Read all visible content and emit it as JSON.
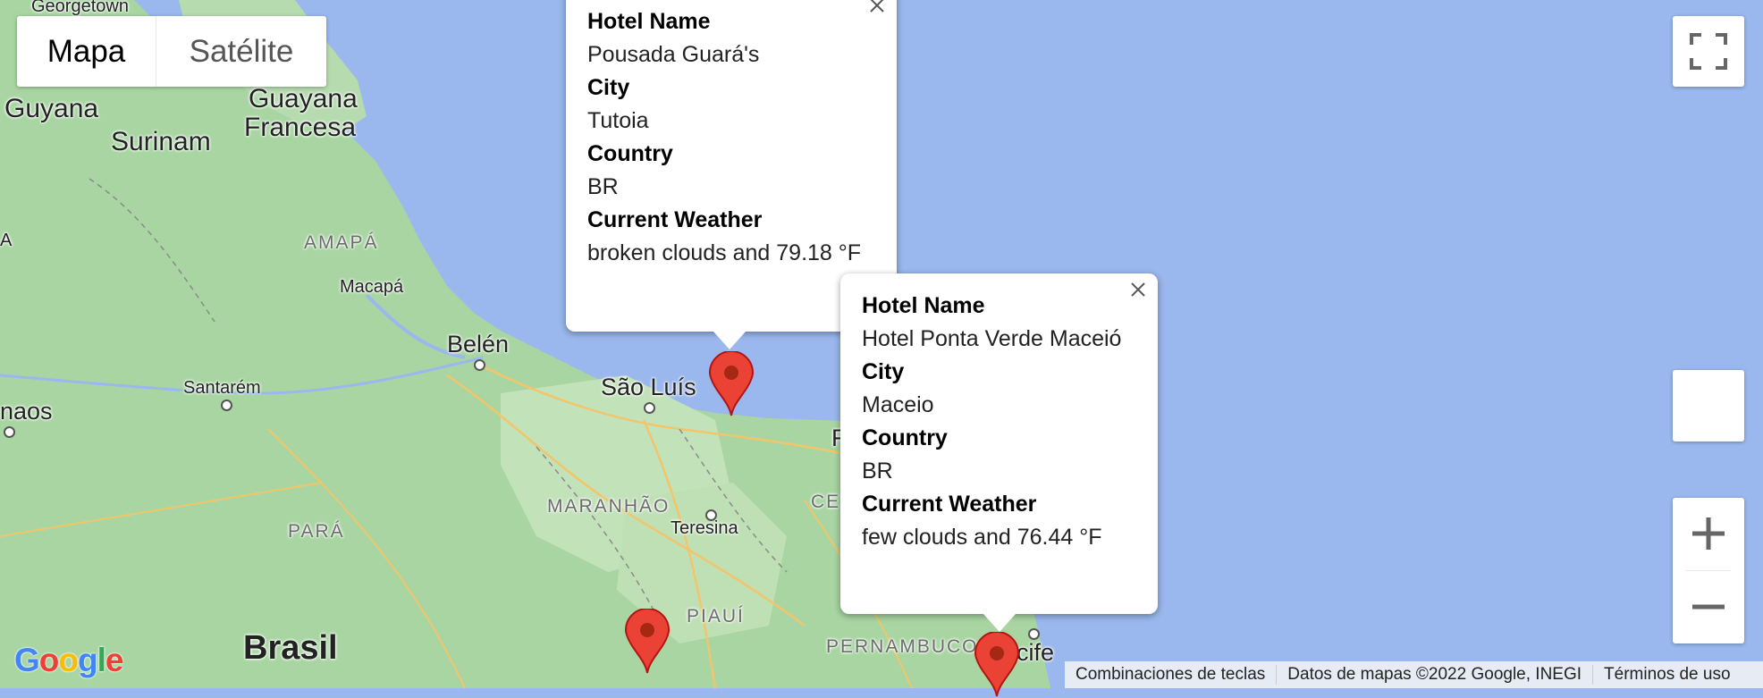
{
  "map": {
    "type_control": {
      "map_label": "Mapa",
      "satellite_label": "Satélite",
      "selected": "Mapa"
    },
    "labels": {
      "georgetown": "Georgetown",
      "guyana": "Guyana",
      "guayana_francesa_1": "Guayana",
      "guayana_francesa_2": "Francesa",
      "surinam": "Surinam",
      "amapa": "AMAPÁ",
      "macapa": "Macapá",
      "belen": "Belén",
      "santarem": "Santarém",
      "manaos": "naos",
      "sao_luis": "São Luís",
      "maranhao": "MARANHÃO",
      "teresina": "Teresina",
      "para": "PARÁ",
      "piaui": "PIAUÍ",
      "pernambuco": "PERNAMBUCO",
      "recife": "ecife",
      "ce": "CE",
      "brasil": "Brasil",
      "a_edge": "A",
      "f_edge": "F"
    },
    "info_windows": [
      {
        "hotel_label": "Hotel Name",
        "hotel": "Pousada Guará's",
        "city_label": "City",
        "city": "Tutoia",
        "country_label": "Country",
        "country": "BR",
        "weather_label": "Current Weather",
        "weather": "broken clouds and 79.18 °F"
      },
      {
        "hotel_label": "Hotel Name",
        "hotel": "Hotel Ponta Verde Maceió",
        "city_label": "City",
        "city": "Maceio",
        "country_label": "Country",
        "country": "BR",
        "weather_label": "Current Weather",
        "weather": "few clouds and 76.44 °F"
      }
    ],
    "attribution": {
      "shortcuts": "Combinaciones de teclas",
      "data": "Datos de mapas ©2022 Google, INEGI",
      "terms": "Términos de uso"
    },
    "logo": "Google",
    "colors": {
      "ocean": "#9ab8ee",
      "land": "#a8d5a2",
      "marker": "#ea4335",
      "marker_dark": "#a52714"
    }
  }
}
